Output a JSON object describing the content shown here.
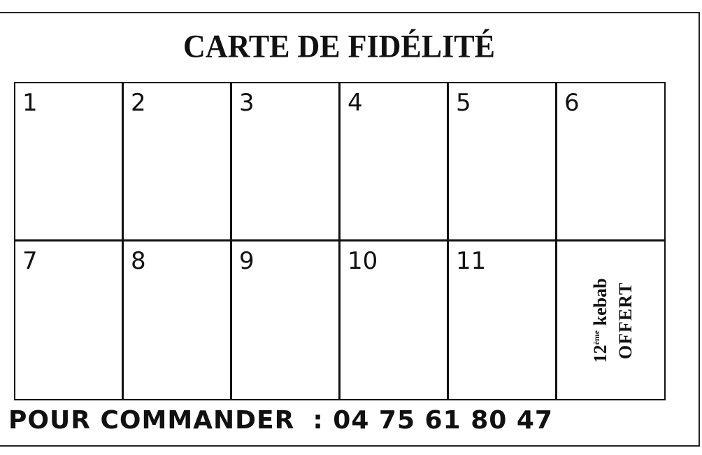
{
  "card": {
    "title": "CARTE DE FIDÉLITÉ",
    "cells": [
      "1",
      "2",
      "3",
      "4",
      "5",
      "6",
      "7",
      "8",
      "9",
      "10",
      "11"
    ],
    "reward": {
      "number": "12",
      "superscript": "ème",
      "item": "kebab",
      "status": "OFFERT"
    },
    "footer": {
      "label": "POUR COMMANDER",
      "colon": ":",
      "phone": "04 75 61 80 47"
    }
  }
}
